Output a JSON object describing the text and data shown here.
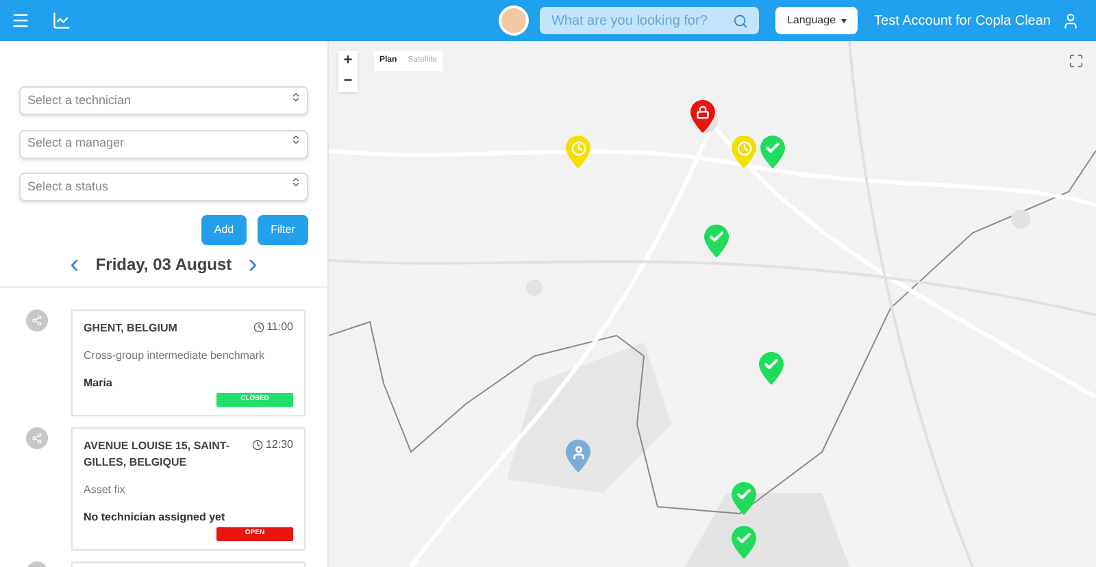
{
  "header": {
    "search": {
      "placeholder": "What are you looking for?"
    },
    "language": "Language",
    "account": "Test Account for Copla Clean"
  },
  "filters": [
    {
      "placeholder": "Select a technician"
    },
    {
      "placeholder": "Select a manager"
    },
    {
      "placeholder": "Select a status"
    }
  ],
  "buttons": [
    "Add",
    "Filter"
  ],
  "date": {
    "prev": "‹",
    "label": "Friday, 03 August",
    "next": "›"
  },
  "jobs": [
    {
      "address": "GHENT, BELGIUM",
      "time": "11:00",
      "description": "Cross-group intermediate benchmark",
      "assignee": "Maria",
      "status": "CLOSED",
      "kind": "closed"
    },
    {
      "address": "AVENUE LOUISE 15, SAINT-GILLES, BELGIQUE",
      "time": "12:30",
      "description": "Asset fix",
      "assignee": "No technician assigned yet",
      "status": "OPEN",
      "kind": "open"
    }
  ],
  "map": {
    "zoom_in": "+",
    "zoom_out": "−",
    "modes": [
      {
        "label": "Plan",
        "selected": true
      },
      {
        "label": "Satellite",
        "selected": false
      }
    ],
    "markers": [
      {
        "kind": "lock",
        "color": "#e8140e"
      },
      {
        "kind": "clock",
        "color": "#f2e000"
      },
      {
        "kind": "clock",
        "color": "#f2e000"
      },
      {
        "kind": "check",
        "color": "#1fdc5a"
      },
      {
        "kind": "check",
        "color": "#1fdc5a"
      },
      {
        "kind": "check",
        "color": "#1fdc5a"
      },
      {
        "kind": "person",
        "color": "#7eaad6"
      },
      {
        "kind": "check",
        "color": "#1fdc5a"
      },
      {
        "kind": "check",
        "color": "#1fdc5a"
      }
    ]
  }
}
